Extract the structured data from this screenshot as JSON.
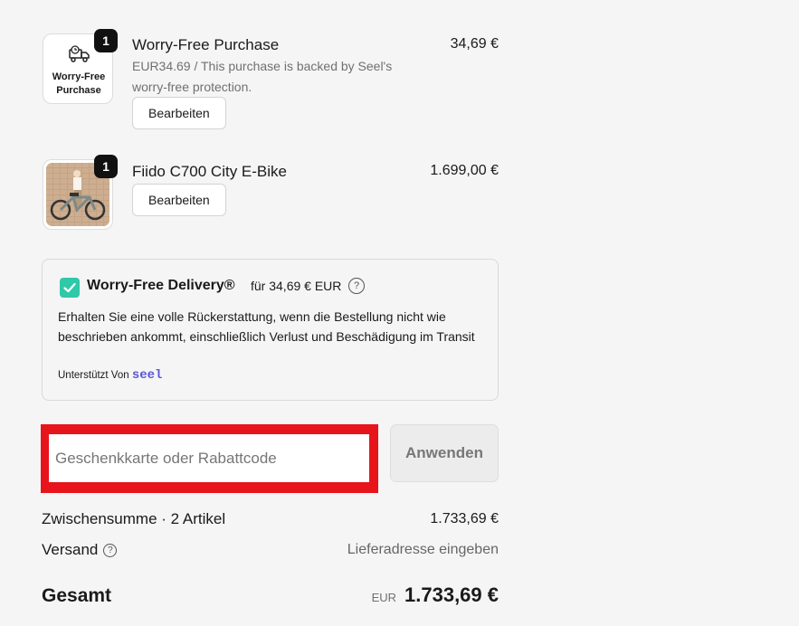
{
  "line_items": [
    {
      "quantity": "1",
      "thumb_text_1": "Worry-Free",
      "thumb_text_2": "Purchase",
      "title": "Worry-Free Purchase",
      "subtitle": "EUR34.69 / This purchase is backed by Seel's worry-free protection.",
      "price": "34,69 €",
      "edit_label": "Bearbeiten",
      "icon": "delivery-truck-icon"
    },
    {
      "quantity": "1",
      "title": "Fiido C700 City E-Bike",
      "price": "1.699,00 €",
      "edit_label": "Bearbeiten",
      "image": "e-bike-product-photo"
    }
  ],
  "seel": {
    "title": "Worry-Free Delivery®",
    "price_text": "für 34,69 € EUR",
    "description": "Erhalten Sie eine volle Rückerstattung, wenn die Bestellung nicht wie beschrieben ankommt, einschließlich Verlust und Beschädigung im Transit",
    "powered_by": "Unterstützt Von",
    "brand": "seel",
    "checked": true,
    "accent": "#2fc8a8"
  },
  "discount": {
    "placeholder": "Geschenkkarte oder Rabattcode",
    "value": "",
    "apply_label": "Anwenden",
    "highlight_color": "#e8141c"
  },
  "summary": {
    "subtotal_label": "Zwischensumme · 2 Artikel",
    "subtotal_value": "1.733,69 €",
    "shipping_label": "Versand",
    "shipping_value": "Lieferadresse eingeben",
    "total_label": "Gesamt",
    "currency": "EUR",
    "total_value": "1.733,69 €"
  }
}
